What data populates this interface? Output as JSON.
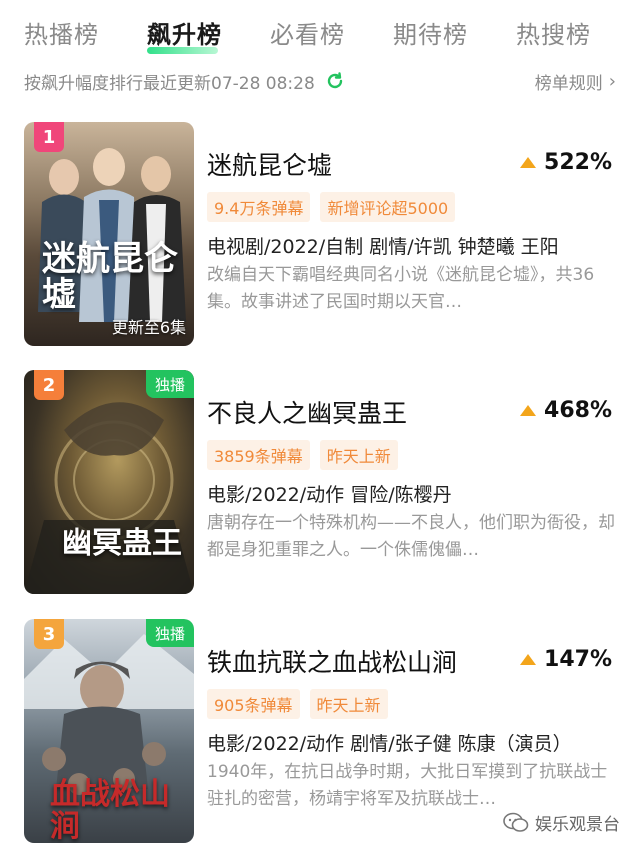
{
  "tabs": [
    {
      "label": "热播榜",
      "active": false
    },
    {
      "label": "飙升榜",
      "active": true
    },
    {
      "label": "必看榜",
      "active": false
    },
    {
      "label": "期待榜",
      "active": false
    },
    {
      "label": "热搜榜",
      "active": false
    }
  ],
  "subbar": {
    "description": "按飙升幅度排行最近更新07-28 08:28",
    "refresh_icon": "refresh-icon",
    "rules_label": "榜单规则",
    "rules_chevron": "›"
  },
  "colors": {
    "accent_green": "#23c35f",
    "rank1": "#f0467a",
    "rank2": "#f57f3a",
    "rank3": "#f4a53d",
    "trend_up": "#f3a51b",
    "tag_text": "#f08a3a",
    "tag_bg": "#fdf1e6"
  },
  "items": [
    {
      "rank": "1",
      "exclusive": "",
      "poster_title": "迷航昆仑墟",
      "poster_update": "更新至6集",
      "title": "迷航昆仑墟",
      "trend": "522%",
      "tags": [
        "9.4万条弹幕",
        "新增评论超5000"
      ],
      "meta": "电视剧/2022/自制 剧情/许凯 钟楚曦 王阳",
      "summary": "改编自天下霸唱经典同名小说《迷航昆仑墟》，共36集。故事讲述了民国时期以天官…"
    },
    {
      "rank": "2",
      "exclusive": "独播",
      "poster_title": "幽冥蛊王",
      "poster_update": "",
      "title": "不良人之幽冥蛊王",
      "trend": "468%",
      "tags": [
        "3859条弹幕",
        "昨天上新"
      ],
      "meta": "电影/2022/动作 冒险/陈樱丹",
      "summary": "唐朝存在一个特殊机构——不良人，他们职为衙役，却都是身犯重罪之人。一个侏儒傀儡…"
    },
    {
      "rank": "3",
      "exclusive": "独播",
      "poster_title": "血战松山涧",
      "poster_update": "",
      "title": "铁血抗联之血战松山涧",
      "trend": "147%",
      "tags": [
        "905条弹幕",
        "昨天上新"
      ],
      "meta": "电影/2022/动作 剧情/张子健 陈康（演员）",
      "summary": "1940年，在抗日战争时期，大批日军摸到了抗联战士驻扎的密营，杨靖宇将军及抗联战士…"
    }
  ],
  "watermark": {
    "icon": "wechat-icon",
    "text": "娱乐观景台"
  }
}
